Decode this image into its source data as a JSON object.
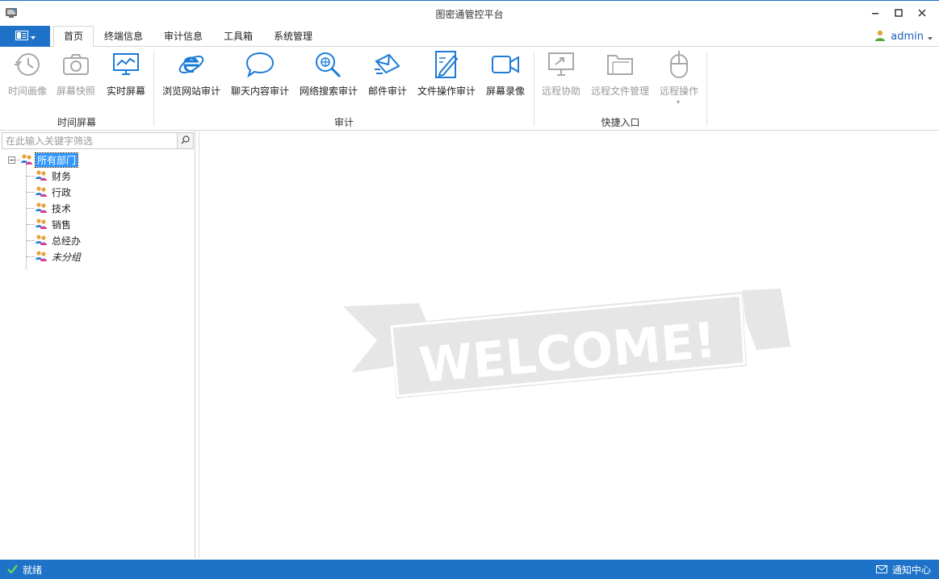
{
  "window": {
    "title": "图密通管控平台"
  },
  "tabs": [
    {
      "label": "首页",
      "active": true
    },
    {
      "label": "终端信息"
    },
    {
      "label": "审计信息"
    },
    {
      "label": "工具箱"
    },
    {
      "label": "系统管理"
    }
  ],
  "user": {
    "name": "admin"
  },
  "ribbon": {
    "groups": [
      {
        "label": "时间屏幕"
      },
      {
        "label": "审计"
      },
      {
        "label": "快捷入口"
      }
    ],
    "items": [
      {
        "label": "时间画像",
        "icon": "history-clock-icon",
        "enabled": false
      },
      {
        "label": "屏幕快照",
        "icon": "camera-icon",
        "enabled": false
      },
      {
        "label": "实时屏幕",
        "icon": "monitor-chart-icon",
        "enabled": true
      },
      {
        "label": "浏览网站审计",
        "icon": "internet-explorer-icon",
        "enabled": true
      },
      {
        "label": "聊天内容审计",
        "icon": "chat-bubble-icon",
        "enabled": true
      },
      {
        "label": "网络搜索审计",
        "icon": "globe-search-icon",
        "enabled": true
      },
      {
        "label": "邮件审计",
        "icon": "mail-send-icon",
        "enabled": true
      },
      {
        "label": "文件操作审计",
        "icon": "document-edit-icon",
        "enabled": true
      },
      {
        "label": "屏幕录像",
        "icon": "video-camera-icon",
        "enabled": true
      },
      {
        "label": "远程协助",
        "icon": "remote-monitor-icon",
        "enabled": false
      },
      {
        "label": "远程文件管理",
        "icon": "folder-icon",
        "enabled": false
      },
      {
        "label": "远程操作",
        "icon": "mouse-icon",
        "enabled": false
      }
    ]
  },
  "left_panel": {
    "search_placeholder": "在此输入关键字筛选",
    "tree": {
      "root": "所有部门",
      "children": [
        "财务",
        "行政",
        "技术",
        "销售",
        "总经办",
        "未分组"
      ]
    }
  },
  "main": {
    "watermark": "WELCOME!"
  },
  "status": {
    "left": "就绪",
    "right": "通知中心"
  },
  "colors": {
    "accent": "#1e73c8",
    "icon_blue": "#1b7bd6",
    "disabled": "#9a9a9a",
    "selection": "#3399ff",
    "watermark": "#e6e6e6"
  }
}
